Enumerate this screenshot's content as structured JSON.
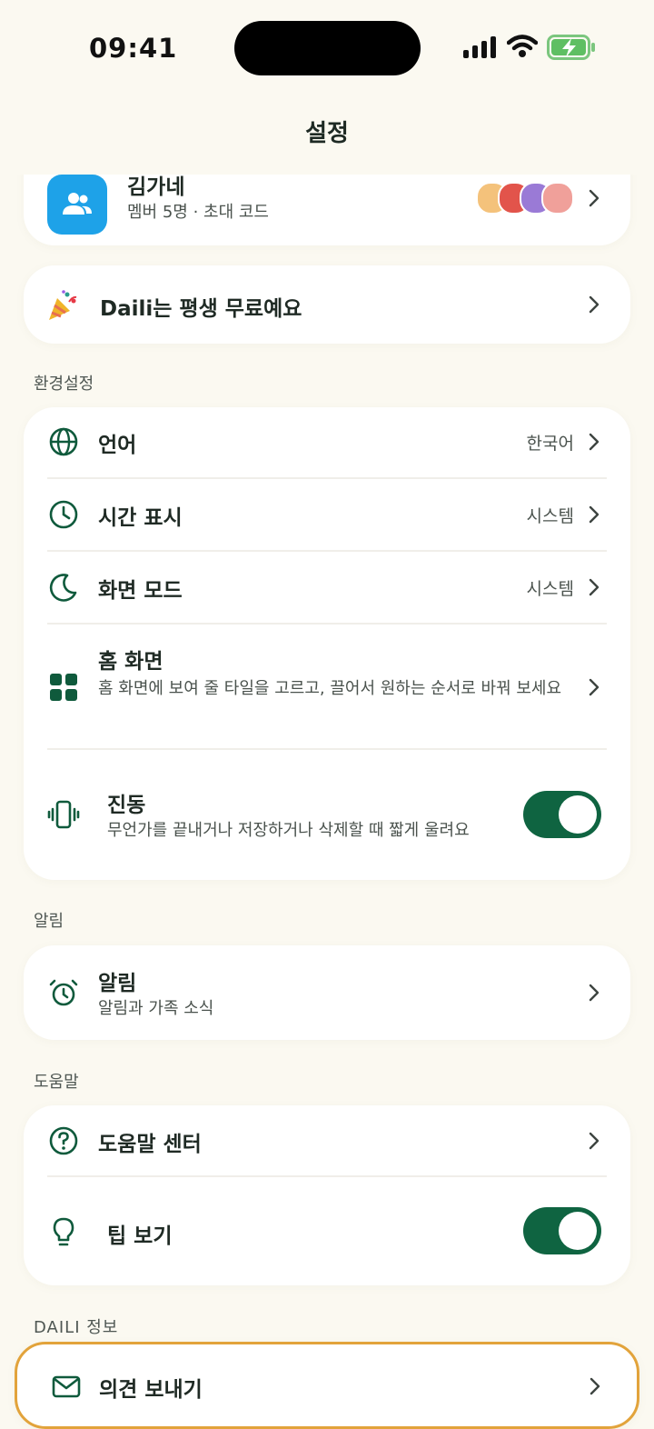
{
  "status_bar": {
    "time": "09:41"
  },
  "header": {
    "title": "설정"
  },
  "family": {
    "name": "김가네",
    "subtitle": "멤버 5명 · 초대 코드"
  },
  "promo": {
    "label": "Daili는 평생 무료예요"
  },
  "sections": {
    "preferences": "환경설정",
    "notifications": "알림",
    "help": "도움말",
    "about": "DAILI 정보"
  },
  "preferences": {
    "language": {
      "label": "언어",
      "value": "한국어"
    },
    "time_display": {
      "label": "시간 표시",
      "value": "시스템"
    },
    "screen_mode": {
      "label": "화면 모드",
      "value": "시스템"
    },
    "home_screen": {
      "label": "홈 화면",
      "description": "홈 화면에 보여 줄 타일을 고르고, 끌어서 원하는 순서로 바꿔 보세요"
    },
    "vibration": {
      "label": "진동",
      "description": "무언가를 끝내거나 저장하거나 삭제할 때 짧게 울려요",
      "enabled": true
    }
  },
  "notifications": {
    "alerts": {
      "label": "알림",
      "description": "알림과 가족 소식"
    }
  },
  "help": {
    "help_center": {
      "label": "도움말 센터"
    },
    "tips": {
      "label": "팁 보기",
      "enabled": true
    }
  },
  "about": {
    "feedback": {
      "label": "의견 보내기"
    }
  },
  "colors": {
    "accent": "#0f6441",
    "background": "#fbf9f1",
    "highlight": "#e2a33b",
    "family_icon_bg": "#1ea2e8"
  }
}
